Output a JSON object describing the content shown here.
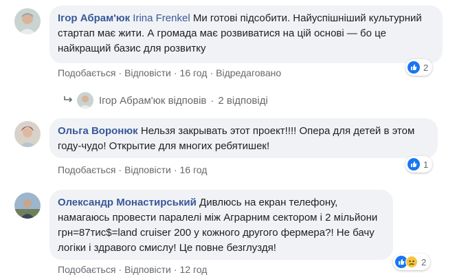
{
  "comments": [
    {
      "author": "Ігор Абрам'юк",
      "mention": "Irina Frenkel",
      "text": " Ми готові підсобити. Найуспішніший культурний стартап має жити. А громада має розвиватися на цій основі — бо це найкращий базис для розвитку",
      "like_label": "Подобається",
      "reply_label": "Відповісти",
      "time": "16 год",
      "edited": "Відредаговано",
      "reaction_count": "2"
    },
    {
      "author": "Ольга Воронюк",
      "text": " Нельзя закрывать этот проект!!!! Опера для детей в этом году-чудо! Открытие для многих ребятишек!",
      "like_label": "Подобається",
      "reply_label": "Відповісти",
      "time": "16 год",
      "reaction_count": "1"
    },
    {
      "author": "Олександр Монастирський",
      "text": " Дивлюсь на екран телефону, намагаюсь провести паралелі між Аграрним сектором і 2 мільйони грн=87тис$=land cruiser 200 у кожного другого фермера?! Не бачу логіки і здравого смислу! Це повне безглуздя!",
      "like_label": "Подобається",
      "reply_label": "Відповісти",
      "time": "12 год",
      "reaction_count": "2"
    }
  ],
  "replies_row": {
    "replier": "Ігор Абрам'юк відповів",
    "count_label": "2 відповіді"
  },
  "colors": {
    "author": "#385898",
    "bubble": "#f0f2f5",
    "meta": "#65676b",
    "like": "#1877f2"
  }
}
